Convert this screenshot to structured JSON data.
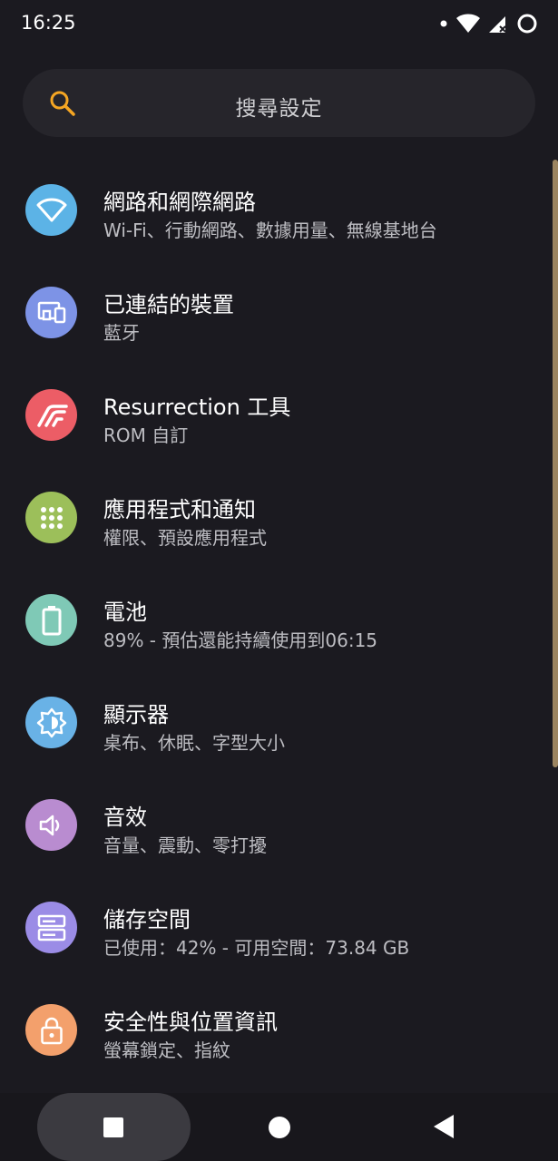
{
  "status": {
    "time": "16:25"
  },
  "search": {
    "placeholder": "搜尋設定"
  },
  "items": [
    {
      "title": "網路和網際網路",
      "subtitle": "Wi-Fi、行動網路、數據用量、無線基地台",
      "color": "#5cb3e6",
      "icon": "wifi-icon"
    },
    {
      "title": "已連結的裝置",
      "subtitle": "藍牙",
      "color": "#7d93e6",
      "icon": "devices-icon"
    },
    {
      "title": "Resurrection 工具",
      "subtitle": "ROM 自訂",
      "color": "#ec5d66",
      "icon": "resurrection-icon"
    },
    {
      "title": "應用程式和通知",
      "subtitle": "權限、預設應用程式",
      "color": "#9cbf5a",
      "icon": "apps-grid-icon"
    },
    {
      "title": "電池",
      "subtitle": "89% - 預估還能持續使用到06:15",
      "color": "#7fc9b6",
      "icon": "battery-icon"
    },
    {
      "title": "顯示器",
      "subtitle": "桌布、休眠、字型大小",
      "color": "#69b2e6",
      "icon": "brightness-icon"
    },
    {
      "title": "音效",
      "subtitle": "音量、震動、零打擾",
      "color": "#b98cd0",
      "icon": "volume-icon"
    },
    {
      "title": "儲存空間",
      "subtitle": "已使用：42% - 可用空間：73.84 GB",
      "color": "#9b8ce6",
      "icon": "storage-icon"
    },
    {
      "title": "安全性與位置資訊",
      "subtitle": "螢幕鎖定、指紋",
      "color": "#f3a06c",
      "icon": "lock-icon"
    }
  ],
  "colors": {
    "background": "#1b1a20",
    "accent": "#f5a623"
  }
}
